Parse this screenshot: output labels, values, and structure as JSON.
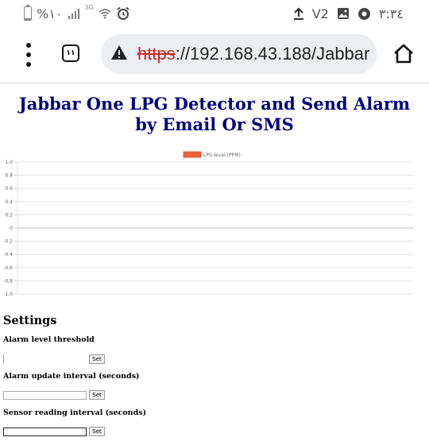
{
  "status_bar": {
    "battery_text": "%١٠",
    "battery_level": 0.1,
    "network_type": "3G",
    "volte": "V2",
    "time": "٣:٣٤"
  },
  "browser": {
    "tab_count": "١١",
    "url_scheme": "https",
    "url_rest": "://192.168.43.188/Jabbar"
  },
  "page": {
    "title": "Jabbar One LPG Detector and Send Alarm by Email Or SMS"
  },
  "chart_data": {
    "type": "line",
    "series": [
      {
        "name": "LPG level (PPM)",
        "values": []
      }
    ],
    "ylim": [
      -1.0,
      1.0
    ],
    "y_ticks": [
      "1.0",
      "0.8",
      "0.6",
      "0.4",
      "0.2",
      "0",
      "-0.2",
      "-0.4",
      "-0.6",
      "-0.8",
      "-1.0"
    ],
    "grid": true,
    "legend_position": "top-center",
    "series_color": "#e8623a"
  },
  "settings": {
    "title": "Settings",
    "items": [
      {
        "label": "Alarm level threshold",
        "value": "",
        "button": "Set"
      },
      {
        "label": "Alarm update interval (seconds)",
        "value": "",
        "button": "Set"
      },
      {
        "label": "Sensor reading interval (seconds)",
        "value": "",
        "button": "Set"
      }
    ]
  }
}
